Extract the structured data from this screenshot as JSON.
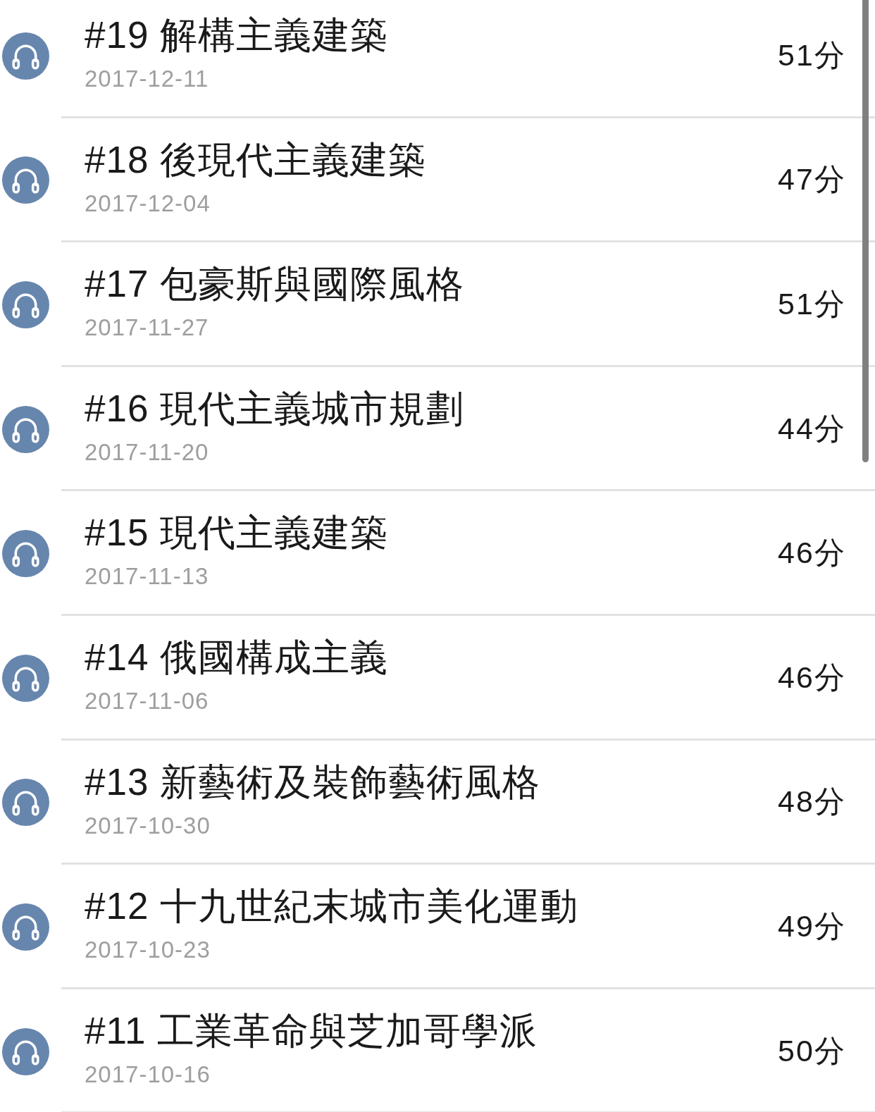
{
  "episodes": [
    {
      "title": "#19 解構主義建築",
      "date": "2017-12-11",
      "duration": "51分"
    },
    {
      "title": "#18 後現代主義建築",
      "date": "2017-12-04",
      "duration": "47分"
    },
    {
      "title": "#17 包豪斯與國際風格",
      "date": "2017-11-27",
      "duration": "51分"
    },
    {
      "title": "#16 現代主義城市規劃",
      "date": "2017-11-20",
      "duration": "44分"
    },
    {
      "title": "#15 現代主義建築",
      "date": "2017-11-13",
      "duration": "46分"
    },
    {
      "title": "#14 俄國構成主義",
      "date": "2017-11-06",
      "duration": "46分"
    },
    {
      "title": "#13 新藝術及裝飾藝術風格",
      "date": "2017-10-30",
      "duration": "48分"
    },
    {
      "title": "#12 十九世紀末城市美化運動",
      "date": "2017-10-23",
      "duration": "49分"
    },
    {
      "title": "#11 工業革命與芝加哥學派",
      "date": "2017-10-16",
      "duration": "50分"
    }
  ]
}
